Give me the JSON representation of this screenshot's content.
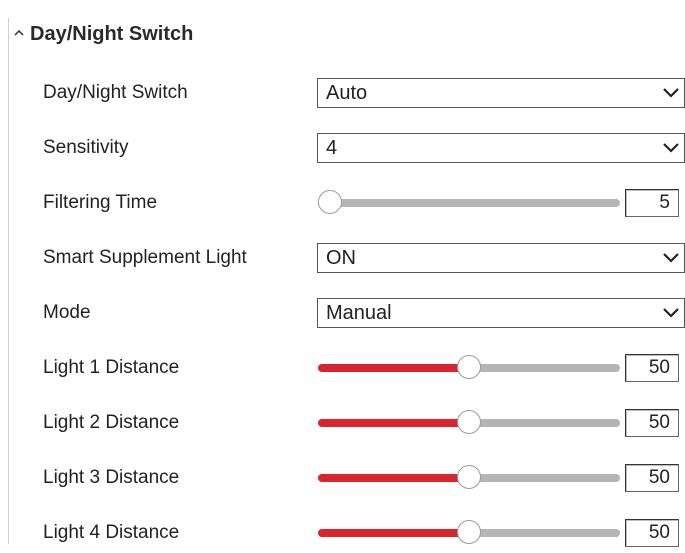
{
  "section": {
    "title": "Day/Night Switch",
    "collapse_icon": "caret-up-icon"
  },
  "settings": {
    "day_night_switch": {
      "label": "Day/Night Switch",
      "value": "Auto"
    },
    "sensitivity": {
      "label": "Sensitivity",
      "value": "4"
    },
    "filtering_time": {
      "label": "Filtering Time",
      "value": "5",
      "level": 0
    },
    "smart_supplement_light": {
      "label": "Smart Supplement Light",
      "value": "ON"
    },
    "mode": {
      "label": "Mode",
      "value": "Manual"
    },
    "light1_distance": {
      "label": "Light 1 Distance",
      "value": "50",
      "level": 0.5
    },
    "light2_distance": {
      "label": "Light 2 Distance",
      "value": "50",
      "level": 0.5
    },
    "light3_distance": {
      "label": "Light 3 Distance",
      "value": "50",
      "level": 0.5
    },
    "light4_distance": {
      "label": "Light 4 Distance",
      "value": "50",
      "level": 0.5
    }
  },
  "icons": {
    "dropdown": "chevron-down-icon",
    "slider_thumb": "slider-thumb"
  },
  "colors": {
    "slider_fill": "#d9262e",
    "slider_track": "#b5b5b5"
  }
}
